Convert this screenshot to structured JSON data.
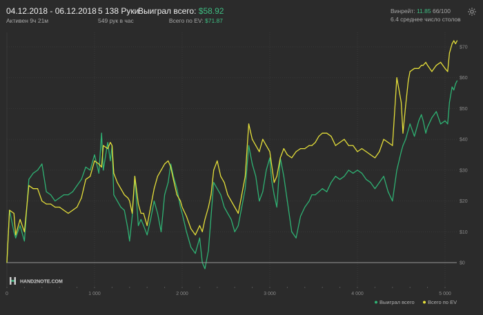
{
  "header": {
    "date_range": "04.12.2018 - 06.12.2018",
    "active_time": "Активен 9ч 21м",
    "hands": "5 138 Руки",
    "hands_per_hour": "549 рук в час",
    "won_total_label": "Выиграл всего:",
    "won_total_value": "$58.92",
    "ev_total_label": "Всего по EV:",
    "ev_total_value": "$71.87",
    "winrate_label": "Винрейт:",
    "winrate_value": "11.85",
    "winrate_suffix": "66/100",
    "avg_tables": "6.4 среднее число столов"
  },
  "colors": {
    "won": "#2fb374",
    "ev": "#e6e03a",
    "background": "#2b2b2b",
    "axis": "#9a9a9a",
    "grid": "#393939"
  },
  "logo": {
    "text": "HAND2NOTE.COM"
  },
  "chart_data": {
    "type": "line",
    "title": "",
    "xlabel": "",
    "ylabel": "",
    "xlim": [
      0,
      5138
    ],
    "ylim": [
      -5,
      75
    ],
    "x_ticks": [
      0,
      1000,
      2000,
      3000,
      4000,
      5000
    ],
    "x_tick_labels": [
      "0",
      "1 000",
      "2 000",
      "3 000",
      "4 000",
      "5 000"
    ],
    "y_ticks": [
      0,
      10,
      20,
      30,
      40,
      50,
      60,
      70
    ],
    "y_tick_labels": [
      "$0",
      "$10",
      "$20",
      "$30",
      "$40",
      "$50",
      "$60",
      "$70"
    ],
    "grid": true,
    "legend_position": "bottom-right",
    "series": [
      {
        "name": "Выиграл всего",
        "color": "#2fb374",
        "x": [
          0,
          30,
          80,
          100,
          150,
          200,
          250,
          300,
          350,
          400,
          450,
          500,
          550,
          600,
          650,
          700,
          750,
          800,
          850,
          900,
          950,
          1000,
          1050,
          1080,
          1100,
          1150,
          1180,
          1200,
          1220,
          1260,
          1300,
          1340,
          1380,
          1400,
          1430,
          1460,
          1500,
          1530,
          1560,
          1600,
          1640,
          1680,
          1720,
          1760,
          1800,
          1840,
          1870,
          1900,
          1940,
          1980,
          2000,
          2050,
          2100,
          2150,
          2200,
          2230,
          2260,
          2300,
          2330,
          2360,
          2400,
          2440,
          2480,
          2520,
          2560,
          2600,
          2640,
          2680,
          2720,
          2760,
          2800,
          2840,
          2880,
          2920,
          2960,
          3000,
          3020,
          3050,
          3080,
          3120,
          3160,
          3200,
          3250,
          3300,
          3350,
          3400,
          3450,
          3480,
          3520,
          3560,
          3600,
          3650,
          3700,
          3750,
          3800,
          3850,
          3900,
          3950,
          4000,
          4050,
          4100,
          4150,
          4200,
          4250,
          4300,
          4350,
          4400,
          4450,
          4500,
          4520,
          4550,
          4580,
          4600,
          4650,
          4700,
          4730,
          4750,
          4780,
          4800,
          4850,
          4900,
          4950,
          5000,
          5030,
          5050,
          5080,
          5100,
          5120,
          5138
        ],
        "values": [
          0,
          17,
          10,
          8,
          12,
          7,
          27,
          29,
          30,
          32,
          23,
          22,
          20,
          21,
          22,
          22,
          23,
          25,
          27,
          31,
          30,
          35,
          29,
          42,
          30,
          39,
          33,
          38,
          22,
          20,
          18,
          17,
          11,
          7,
          15,
          28,
          12,
          14,
          12,
          9,
          14,
          20,
          16,
          10,
          22,
          26,
          32,
          28,
          24,
          18,
          16,
          10,
          5,
          3,
          8,
          0,
          -2,
          4,
          15,
          26,
          24,
          22,
          18,
          16,
          14,
          10,
          12,
          18,
          24,
          38,
          32,
          28,
          20,
          23,
          30,
          34,
          27,
          22,
          18,
          34,
          28,
          20,
          10,
          8,
          15,
          18,
          20,
          22,
          22,
          23,
          24,
          23,
          26,
          28,
          27,
          28,
          30,
          29,
          30,
          29,
          27,
          26,
          24,
          26,
          28,
          23,
          20,
          30,
          36,
          38,
          40,
          43,
          45,
          41,
          46,
          48,
          46,
          42,
          44,
          47,
          49,
          45,
          46,
          45,
          52,
          57,
          56,
          58,
          59
        ]
      },
      {
        "name": "Всего по EV",
        "color": "#e6e03a",
        "x": [
          0,
          30,
          80,
          100,
          150,
          200,
          250,
          300,
          350,
          400,
          450,
          500,
          550,
          600,
          650,
          700,
          750,
          800,
          850,
          900,
          950,
          1000,
          1050,
          1080,
          1100,
          1150,
          1180,
          1200,
          1220,
          1260,
          1300,
          1340,
          1380,
          1400,
          1430,
          1460,
          1500,
          1530,
          1560,
          1600,
          1640,
          1680,
          1720,
          1760,
          1800,
          1840,
          1870,
          1900,
          1940,
          1980,
          2000,
          2050,
          2100,
          2150,
          2200,
          2230,
          2260,
          2300,
          2330,
          2360,
          2400,
          2440,
          2480,
          2520,
          2560,
          2600,
          2640,
          2680,
          2720,
          2760,
          2800,
          2840,
          2880,
          2920,
          2960,
          3000,
          3020,
          3050,
          3080,
          3120,
          3160,
          3200,
          3250,
          3300,
          3350,
          3400,
          3450,
          3480,
          3520,
          3560,
          3600,
          3650,
          3700,
          3750,
          3800,
          3850,
          3900,
          3950,
          4000,
          4050,
          4100,
          4150,
          4200,
          4250,
          4300,
          4350,
          4400,
          4450,
          4500,
          4520,
          4550,
          4580,
          4600,
          4650,
          4700,
          4730,
          4750,
          4780,
          4800,
          4850,
          4900,
          4950,
          5000,
          5030,
          5050,
          5080,
          5100,
          5120,
          5138
        ],
        "values": [
          0,
          17,
          16,
          9,
          14,
          10,
          25,
          24,
          24,
          20,
          19,
          19,
          18,
          18,
          17,
          16,
          17,
          18,
          21,
          27,
          28,
          33,
          32,
          31,
          38,
          37,
          39,
          38,
          29,
          26,
          24,
          22,
          21,
          20,
          16,
          28,
          19,
          16,
          16,
          12,
          18,
          24,
          28,
          30,
          32,
          33,
          31,
          27,
          22,
          20,
          18,
          15,
          11,
          9,
          12,
          10,
          14,
          18,
          22,
          30,
          33,
          28,
          26,
          22,
          20,
          18,
          16,
          22,
          28,
          45,
          40,
          38,
          36,
          40,
          38,
          36,
          32,
          26,
          28,
          34,
          37,
          35,
          34,
          36,
          37,
          37,
          38,
          38,
          39,
          41,
          42,
          42,
          41,
          38,
          39,
          40,
          38,
          38,
          36,
          37,
          36,
          35,
          34,
          36,
          40,
          39,
          38,
          60,
          52,
          42,
          51,
          59,
          62,
          63,
          63,
          64,
          64,
          65,
          64,
          62,
          64,
          65,
          63,
          62,
          68,
          71,
          72,
          71,
          72
        ]
      }
    ]
  }
}
